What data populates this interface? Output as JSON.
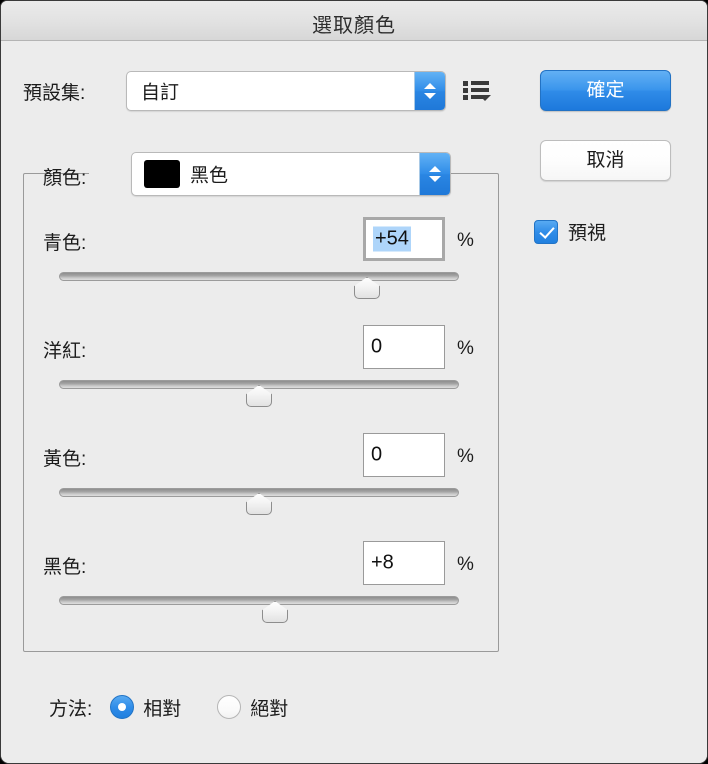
{
  "window": {
    "title": "選取顏色"
  },
  "preset": {
    "label": "預設集:",
    "value": "自訂",
    "options_icon": "list-options-icon"
  },
  "buttons": {
    "ok": "確定",
    "cancel": "取消"
  },
  "preview": {
    "label": "預視",
    "checked": true
  },
  "color": {
    "label": "顏色:",
    "value": "黑色",
    "swatch_hex": "#000000"
  },
  "channels": [
    {
      "label": "青色:",
      "value": "+54",
      "unit": "%",
      "slider_percent": 77,
      "focused": true,
      "selected": true
    },
    {
      "label": "洋紅:",
      "value": "0",
      "unit": "%",
      "slider_percent": 50,
      "focused": false,
      "selected": false
    },
    {
      "label": "黃色:",
      "value": "0",
      "unit": "%",
      "slider_percent": 50,
      "focused": false,
      "selected": false
    },
    {
      "label": "黑色:",
      "value": "+8",
      "unit": "%",
      "slider_percent": 54,
      "focused": false,
      "selected": false
    }
  ],
  "method": {
    "label": "方法:",
    "options": [
      {
        "label": "相對",
        "checked": true
      },
      {
        "label": "絕對",
        "checked": false
      }
    ]
  },
  "colors": {
    "accent": "#2f8ce8",
    "window_bg": "#ececec",
    "selection": "#aed5fa"
  }
}
